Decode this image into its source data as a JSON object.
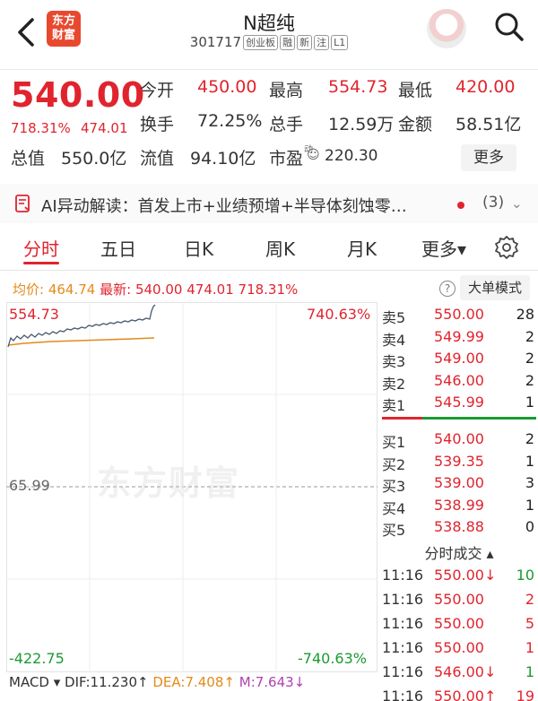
{
  "header": {
    "logo": [
      "东方",
      "财富"
    ],
    "name": "N超纯",
    "code": "301717",
    "tags": [
      "创业板",
      "融",
      "新",
      "注",
      "L1"
    ]
  },
  "quote": {
    "price": "540.00",
    "change_pct": "718.31%",
    "change": "474.01",
    "rows": [
      [
        {
          "label": "今开",
          "value": "450.00",
          "color": "red"
        },
        {
          "label": "最高",
          "value": "554.73",
          "color": "red"
        },
        {
          "label": "最低",
          "value": "420.00",
          "color": "red"
        }
      ],
      [
        {
          "label": "换手",
          "value": "72.25%",
          "color": "dark"
        },
        {
          "label": "总手",
          "value": "12.59万",
          "color": "dark"
        },
        {
          "label": "金额",
          "value": "58.51亿",
          "color": "dark"
        }
      ],
      [
        {
          "label": "总值",
          "value": "550.0亿",
          "color": "dark"
        },
        {
          "label": "流值",
          "value": "94.10亿",
          "color": "dark"
        },
        {
          "label": "市盈",
          "sup": "动",
          "value": "220.30",
          "color": "dark"
        }
      ]
    ],
    "more_label": "更多"
  },
  "ai_bar": {
    "text": "AI异动解读：首发上市+业绩预增+半导体刻蚀零…",
    "count": "(3)"
  },
  "tabs": [
    "分时",
    "五日",
    "日K",
    "周K",
    "月K",
    "更多▾"
  ],
  "info_line": {
    "avg_label": "均价:",
    "avg_value": "464.74",
    "last_label": "最新:",
    "last_value": "540.00",
    "last_change": "474.01",
    "last_pct": "718.31%",
    "help": "?",
    "mode_label": "大单模式"
  },
  "chart": {
    "top_left": "554.73",
    "top_right": "740.63%",
    "mid_left": "65.99",
    "bottom_left": "-422.75",
    "bottom_right": "-740.63%",
    "watermark": "东方财富",
    "price_color": "#4a5a70",
    "avg_color": "#e48a1a"
  },
  "order_book": {
    "sells": [
      {
        "label": "卖5",
        "price": "550.00",
        "vol": "28"
      },
      {
        "label": "卖4",
        "price": "549.99",
        "vol": "2"
      },
      {
        "label": "卖3",
        "price": "549.00",
        "vol": "2"
      },
      {
        "label": "卖2",
        "price": "546.00",
        "vol": "2"
      },
      {
        "label": "卖1",
        "price": "545.99",
        "vol": "1"
      }
    ],
    "buys": [
      {
        "label": "买1",
        "price": "540.00",
        "vol": "2"
      },
      {
        "label": "买2",
        "price": "539.35",
        "vol": "1"
      },
      {
        "label": "买3",
        "price": "539.00",
        "vol": "3"
      },
      {
        "label": "买4",
        "price": "538.99",
        "vol": "1"
      },
      {
        "label": "买5",
        "price": "538.88",
        "vol": "0"
      }
    ]
  },
  "trades": {
    "title": "分时成交 ▴",
    "rows": [
      {
        "time": "11:16",
        "price": "550.00↓",
        "vol": "10",
        "vol_color": "green"
      },
      {
        "time": "11:16",
        "price": "550.00",
        "vol": "2",
        "vol_color": "red"
      },
      {
        "time": "11:16",
        "price": "550.00",
        "vol": "5",
        "vol_color": "red"
      },
      {
        "time": "11:16",
        "price": "550.00",
        "vol": "1",
        "vol_color": "red"
      },
      {
        "time": "11:16",
        "price": "546.00↓",
        "vol": "1",
        "vol_color": "green"
      },
      {
        "time": "11:16",
        "price": "550.00↑",
        "vol": "19",
        "vol_color": "red"
      }
    ]
  },
  "macd": {
    "label": "MACD ▾",
    "dif": "DIF:11.230↑",
    "dea": "DEA:7.408↑",
    "m": "M:7.643↓"
  }
}
